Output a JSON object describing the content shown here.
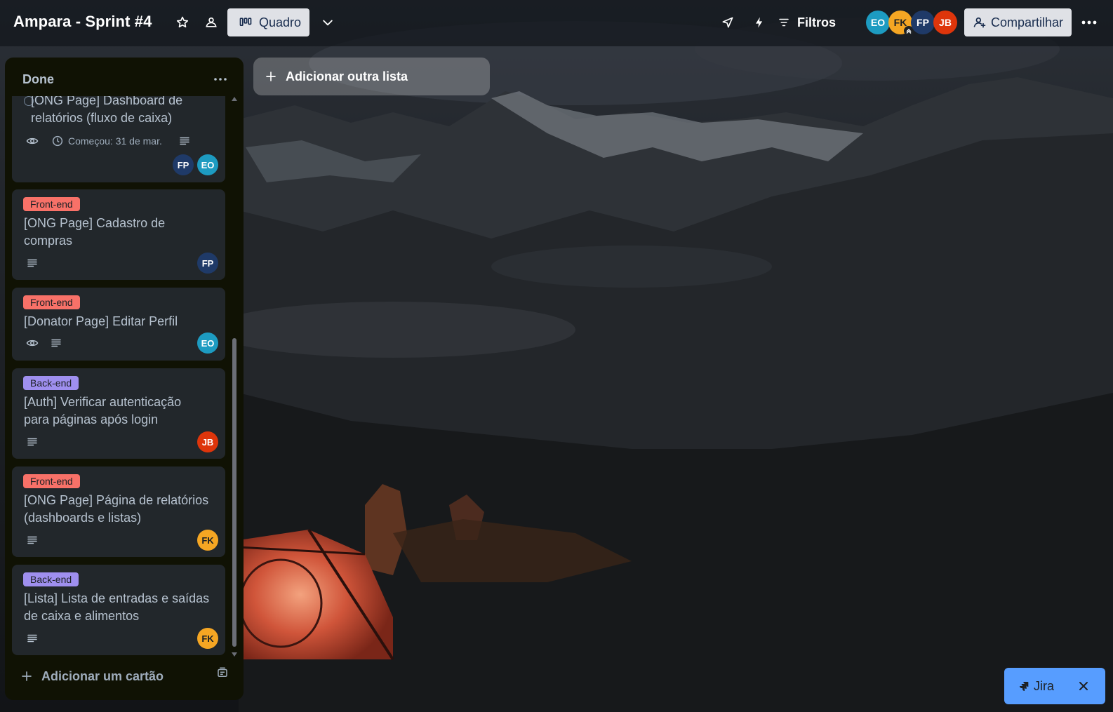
{
  "board": {
    "title": "Ampara - Sprint #4",
    "view_label": "Quadro",
    "filters_label": "Filtros",
    "share_label": "Compartilhar"
  },
  "members": [
    {
      "initials": "EO",
      "color": "#1D9BC1"
    },
    {
      "initials": "FK",
      "color": "#F5A623"
    },
    {
      "initials": "FP",
      "color": "#1F3A68"
    },
    {
      "initials": "JB",
      "color": "#DE350B"
    }
  ],
  "list": {
    "title": "Done",
    "add_card_label": "Adicionar um cartão",
    "cards": [
      {
        "title_line1": "[ONG Page] Dashboard de",
        "title_line2": "relatórios (fluxo de caixa)",
        "date_label": "Começou: 31 de mar.",
        "members": [
          "FP",
          "EO"
        ]
      },
      {
        "label": "Front-end",
        "title_line1": "[ONG Page] Cadastro de",
        "title_line2": "compras",
        "members": [
          "FP"
        ]
      },
      {
        "label": "Front-end",
        "title_line1": "[Donator Page] Editar Perfil",
        "members": [
          "EO"
        ]
      },
      {
        "label": "Back-end",
        "title_line1": "[Auth] Verificar autenticação",
        "title_line2": "para páginas após login",
        "members": [
          "JB"
        ]
      },
      {
        "label": "Front-end",
        "title_line1": "[ONG Page] Página de relatórios",
        "title_line2": "(dashboards e listas)",
        "members": [
          "FK"
        ]
      },
      {
        "label": "Back-end",
        "title_line1": "[Lista] Lista de entradas e saídas",
        "title_line2": "de caixa e alimentos",
        "members": [
          "FK"
        ]
      }
    ]
  },
  "add_list_label": "Adicionar outra lista",
  "jira": {
    "label": "Jira"
  },
  "colors": {
    "label_frontend": "#F87168",
    "label_backend": "#9F8FEF",
    "card_bg": "#22272B",
    "list_bg": "#101204"
  }
}
